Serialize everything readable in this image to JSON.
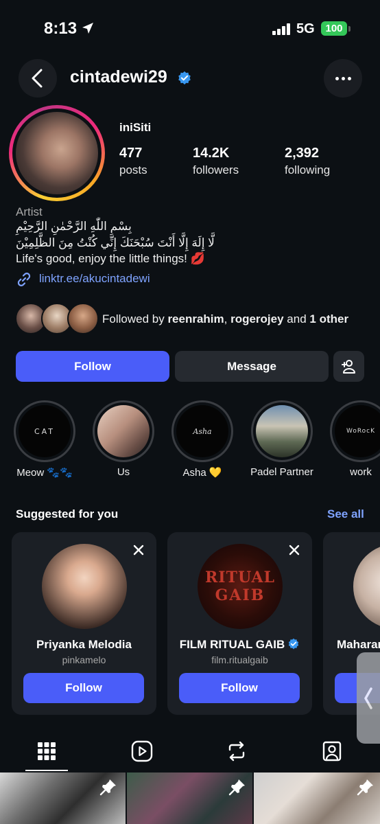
{
  "status": {
    "time": "8:13",
    "network": "5G",
    "battery": "100"
  },
  "header": {
    "username": "cintadewi29"
  },
  "profile": {
    "display_name": "iniSiti",
    "stats": [
      {
        "value": "477",
        "label": "posts"
      },
      {
        "value": "14.2K",
        "label": "followers"
      },
      {
        "value": "2,392",
        "label": "following"
      }
    ],
    "category": "Artist",
    "bio_arabic_1": "بِسْمِ اللّٰهِ الرَّحْمٰنِ الرَّحِيْمِ",
    "bio_arabic_2": "لَّا إِلَهَ إِلَّا أَنْتَ سُبْحَنَكَ إِنِّي كُنْتُ مِنَ الظَّلِمِيْنَ",
    "bio_english": "Life's good, enjoy the little things! 💋",
    "link": "linktr.ee/akucintadewi",
    "followed_by": {
      "prefix": "Followed by ",
      "user1": "reenrahim",
      "sep": ", ",
      "user2": "rogerojey",
      "mid": " and ",
      "others": "1 other"
    }
  },
  "actions": {
    "follow": "Follow",
    "message": "Message"
  },
  "highlights": [
    {
      "label": "Meow 🐾🐾",
      "cover_text": "CAT"
    },
    {
      "label": "Us",
      "cover_text": ""
    },
    {
      "label": "Asha 💛",
      "cover_text": "Asha"
    },
    {
      "label": "Padel Partner",
      "cover_text": ""
    },
    {
      "label": "work",
      "cover_text": "WoRocK"
    }
  ],
  "suggested": {
    "title": "Suggested for you",
    "see_all": "See all",
    "cards": [
      {
        "name": "Priyanka Melodia",
        "handle": "pinkamelo",
        "button": "Follow",
        "verified": false
      },
      {
        "name": "FILM RITUAL GAIB",
        "handle": "film.ritualgaib",
        "button": "Follow",
        "verified": true,
        "poster_text_1": "RITUAL",
        "poster_text_2": "GAIB"
      },
      {
        "name": "Maharan",
        "handle": "",
        "button": "",
        "verified": false
      }
    ]
  },
  "colors": {
    "accent": "#4a5df9",
    "link": "#7fa3ff",
    "background": "#0c1014",
    "verified": "#3897f0"
  }
}
